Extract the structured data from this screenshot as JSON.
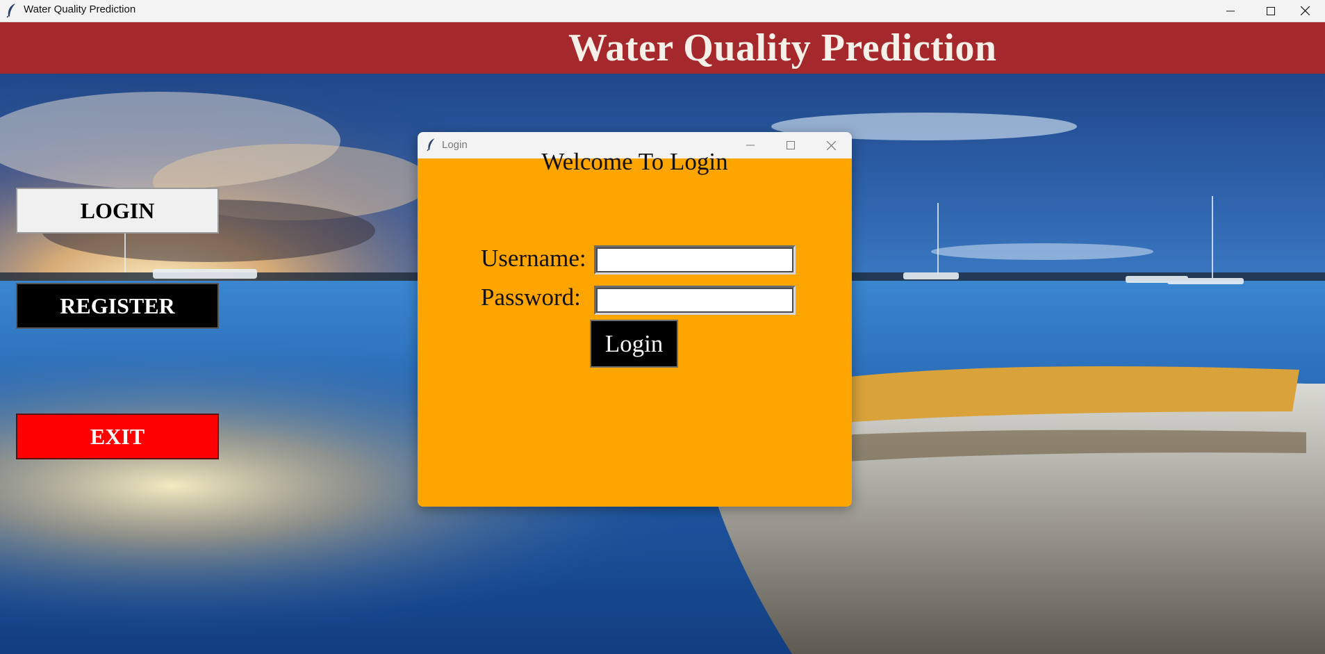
{
  "window": {
    "title": "Water Quality Prediction",
    "icon": "feather-icon"
  },
  "banner": {
    "title": "Water Quality Prediction",
    "color": "#a4282c"
  },
  "sidebar": {
    "login_label": "LOGIN",
    "register_label": "REGISTER",
    "exit_label": "EXIT"
  },
  "dialog": {
    "title": "Login",
    "icon": "feather-icon",
    "background": "#ffa500",
    "welcome": "Welcome To Login",
    "username_label": "Username:",
    "password_label": "Password:",
    "username_value": "",
    "password_value": "",
    "login_button": "Login"
  }
}
